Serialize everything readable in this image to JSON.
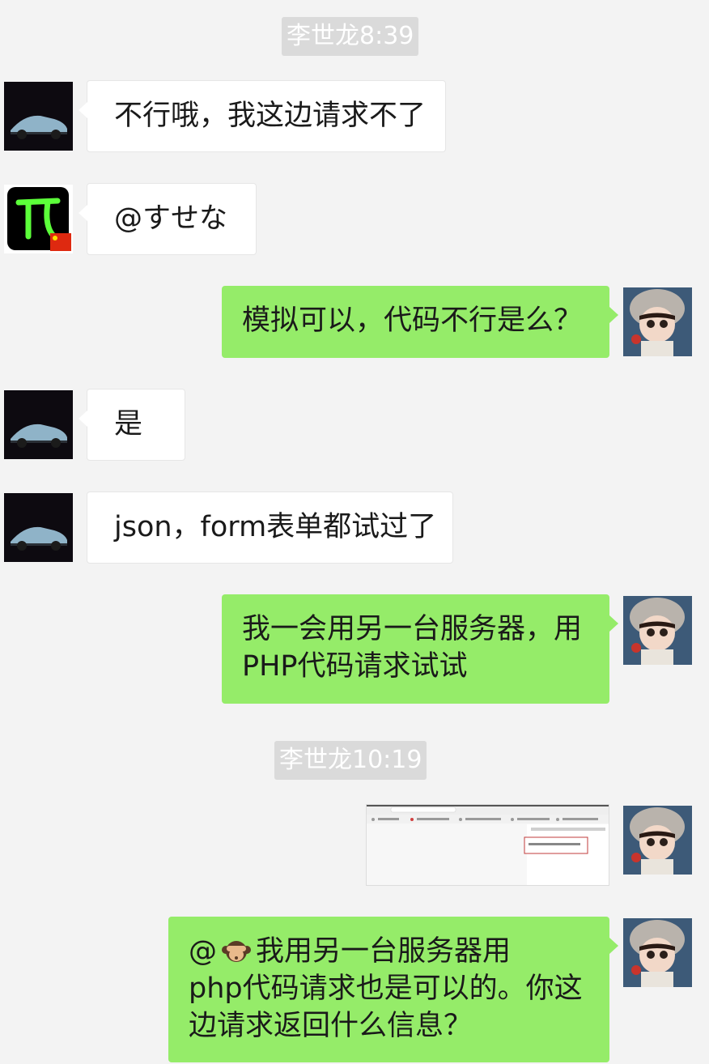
{
  "timestamps": [
    "李世龙8:39",
    "李世龙10:19"
  ],
  "messages": [
    {
      "side": "left",
      "avatar": "car-avatar",
      "lines": [
        "不行哦，我这边请求不了"
      ]
    },
    {
      "side": "left",
      "avatar": "pi-avatar",
      "lines": [
        "@すせな"
      ]
    },
    {
      "side": "right",
      "avatar": "doll-avatar",
      "lines": [
        "模拟可以，代码不行是么？"
      ]
    },
    {
      "side": "left",
      "avatar": "car-avatar",
      "lines": [
        "是"
      ]
    },
    {
      "side": "left",
      "avatar": "car-avatar",
      "lines": [
        "json，form表单都试过了"
      ]
    },
    {
      "side": "right",
      "avatar": "doll-avatar",
      "lines": [
        "我一会用另一台服务器，用",
        "PHP代码请求试试"
      ]
    },
    {
      "side": "right",
      "avatar": "doll-avatar",
      "type": "image",
      "image": "browser-screenshot-thumbnail"
    },
    {
      "side": "right",
      "avatar": "doll-avatar",
      "lines": [
        "@",
        "我用另一台服务器用",
        "php代码请求也是可以的。你这",
        "边请求返回什么信息？"
      ],
      "emoji": "see-no-evil-monkey-emoji"
    }
  ],
  "colors": {
    "background": "#f3f3f3",
    "incoming_bubble": "#ffffff",
    "outgoing_bubble": "#95ec69",
    "timestamp_bg": "#dadada",
    "timestamp_text": "#ffffff"
  }
}
